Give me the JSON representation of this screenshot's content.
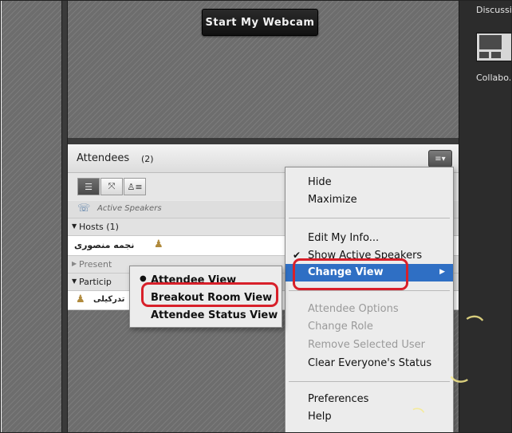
{
  "webcam": {
    "start_label": "Start My Webcam"
  },
  "right_panel": {
    "discussion_label": "Discussi",
    "collab_label": "Collabo."
  },
  "attendees": {
    "title": "Attendees",
    "count": "(2)",
    "active_speakers_label": "Active Speakers",
    "hosts_label": "Hosts (1)",
    "host_user_name": "نجمه منصوری",
    "presenters_label": "Present",
    "participants_label": "Particip",
    "participant_user_name": "تدرکیلی"
  },
  "context_menu": {
    "hide": "Hide",
    "maximize": "Maximize",
    "edit_my_info": "Edit My Info...",
    "show_active_speakers": "Show Active Speakers",
    "change_view": "Change View",
    "attendee_options": "Attendee Options",
    "change_role": "Change Role",
    "remove_selected_user": "Remove Selected User",
    "clear_everyones_status": "Clear Everyone's Status",
    "preferences": "Preferences",
    "help": "Help"
  },
  "submenu": {
    "attendee_view": "Attendee View",
    "breakout_room_view": "Breakout Room View",
    "attendee_status_view": "Attendee Status View"
  },
  "icons": {
    "menu_button": "pod-menu-icon",
    "list_view": "list-view-icon",
    "breakout_view": "breakout-view-icon",
    "status_view": "status-view-icon",
    "speakers": "phone-icon",
    "user": "user-icon"
  },
  "colors": {
    "highlight": "#2f6fc4",
    "annotation_ring": "#d8202a"
  }
}
